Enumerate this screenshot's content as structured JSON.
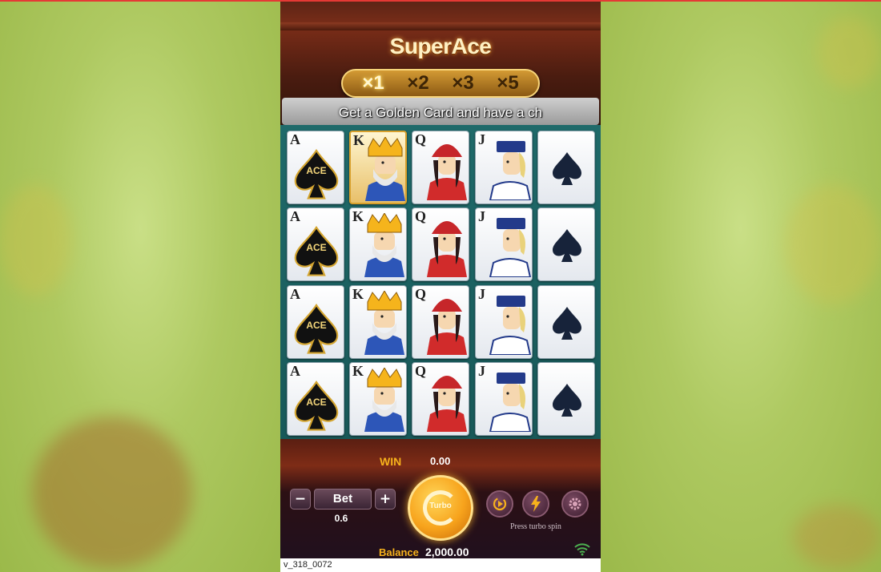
{
  "game": {
    "title": "SuperAce",
    "multipliers": [
      "×1",
      "×2",
      "×3",
      "×5"
    ],
    "active_multiplier": "×1",
    "ticker": "Get a Golden Card and have a ch"
  },
  "grid": {
    "rows": [
      [
        {
          "rank": "A",
          "type": "ace",
          "label": "ACE",
          "golden": false
        },
        {
          "rank": "K",
          "type": "king",
          "golden": true
        },
        {
          "rank": "Q",
          "type": "queen",
          "golden": false
        },
        {
          "rank": "J",
          "type": "jack",
          "golden": false
        },
        {
          "rank": "",
          "type": "spade",
          "golden": false
        }
      ],
      [
        {
          "rank": "A",
          "type": "ace",
          "label": "ACE",
          "golden": false
        },
        {
          "rank": "K",
          "type": "king",
          "golden": false
        },
        {
          "rank": "Q",
          "type": "queen",
          "golden": false
        },
        {
          "rank": "J",
          "type": "jack",
          "golden": false
        },
        {
          "rank": "",
          "type": "spade",
          "golden": false
        }
      ],
      [
        {
          "rank": "A",
          "type": "ace",
          "label": "ACE",
          "golden": false
        },
        {
          "rank": "K",
          "type": "king",
          "golden": false
        },
        {
          "rank": "Q",
          "type": "queen",
          "golden": false
        },
        {
          "rank": "J",
          "type": "jack",
          "golden": false
        },
        {
          "rank": "",
          "type": "spade",
          "golden": false
        }
      ],
      [
        {
          "rank": "A",
          "type": "ace",
          "label": "ACE",
          "golden": false
        },
        {
          "rank": "K",
          "type": "king",
          "golden": false
        },
        {
          "rank": "Q",
          "type": "queen",
          "golden": false
        },
        {
          "rank": "J",
          "type": "jack",
          "golden": false
        },
        {
          "rank": "",
          "type": "spade",
          "golden": false
        }
      ]
    ]
  },
  "footer": {
    "win_label": "WIN",
    "win_value": "0.00",
    "bet_label": "Bet",
    "bet_minus": "−",
    "bet_plus": "+",
    "bet_value": "0.6",
    "spin_label": "Turbo",
    "turbo_hint": "Press turbo spin",
    "balance_label": "Balance",
    "balance_value": "2,000.00",
    "version": "v_318_0072"
  },
  "icons": {
    "autoplay": "autoplay-icon",
    "turbo": "lightning-icon",
    "settings": "gear-icon",
    "wifi": "wifi-icon"
  },
  "colors": {
    "accent_gold": "#f7b21c",
    "board_teal": "#1f6a6a",
    "page_bg": "#a9c85a"
  }
}
